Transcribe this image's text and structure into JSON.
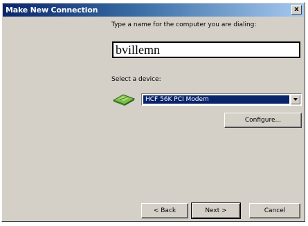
{
  "window": {
    "title": "Make New Connection",
    "close_glyph": "x"
  },
  "form": {
    "name_label": "Type a name for the computer you are dialing:",
    "name_value": "bvillemn",
    "device_label": "Select a device:",
    "device_selected": "HCF 56K PCI Modem",
    "configure_label": "Configure..."
  },
  "buttons": {
    "back_label": "< Back",
    "next_label": "Next >",
    "cancel_label": "Cancel"
  },
  "icons": {
    "modem": "modem-icon",
    "dropdown": "chevron-down-icon",
    "close": "close-icon"
  },
  "colors": {
    "title_start": "#0a246a",
    "title_end": "#a6caf0",
    "selection": "#0a246a",
    "face": "#d4d0c8"
  }
}
